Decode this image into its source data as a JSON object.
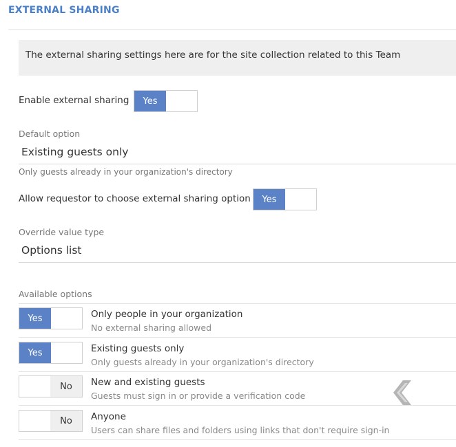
{
  "section": {
    "title": "EXTERNAL SHARING"
  },
  "banner": {
    "text": "The external sharing settings here are for the site collection related to this Team"
  },
  "enable_external_sharing": {
    "label": "Enable external sharing",
    "state_label": "Yes",
    "value": true
  },
  "default_option": {
    "label": "Default option",
    "selected": "Existing guests only",
    "hint": "Only guests already in your organization's directory"
  },
  "allow_requestor": {
    "label": "Allow requestor to choose external sharing option",
    "state_label": "Yes",
    "value": true
  },
  "override_value_type": {
    "label": "Override value type",
    "selected": "Options list"
  },
  "available_options": {
    "label": "Available options",
    "items": [
      {
        "state_label": "Yes",
        "enabled": true,
        "title": "Only people in your organization",
        "description": "No external sharing allowed"
      },
      {
        "state_label": "Yes",
        "enabled": true,
        "title": "Existing guests only",
        "description": "Only guests already in your organization's directory"
      },
      {
        "state_label": "No",
        "enabled": false,
        "title": "New and existing guests",
        "description": "Guests must sign in or provide a verification code"
      },
      {
        "state_label": "No",
        "enabled": false,
        "title": "Anyone",
        "description": "Users can share files and folders using links that don't require sign-in"
      }
    ]
  },
  "icons": {
    "collapse": "chevron-left-icon"
  },
  "colors": {
    "accent": "#4a7fc9",
    "toggle_on": "#5b82c6",
    "banner_bg": "#efefef"
  }
}
